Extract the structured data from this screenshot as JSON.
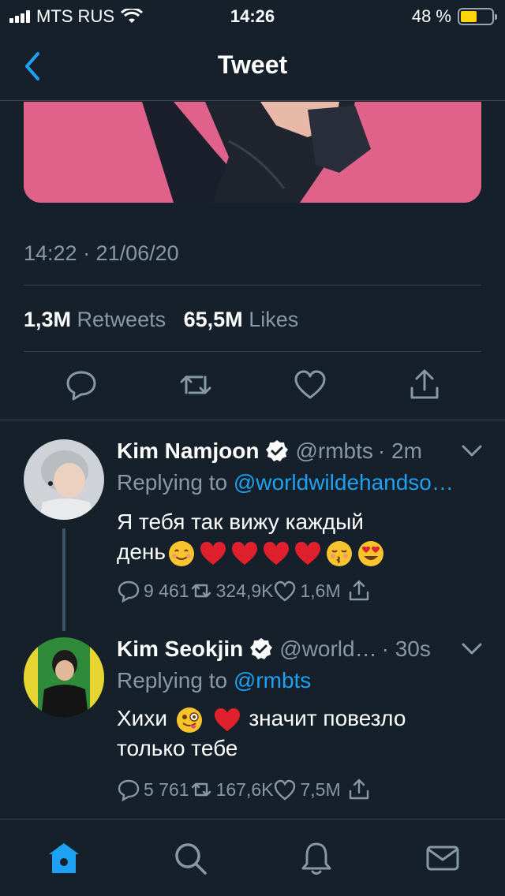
{
  "status_bar": {
    "carrier": "MTS RUS",
    "time": "14:26",
    "battery_percent": "48 %",
    "battery_level": 0.48
  },
  "nav": {
    "title": "Tweet"
  },
  "tweet": {
    "timestamp": "14:22 · 21/06/20",
    "retweets_count": "1,3M",
    "retweets_label": "Retweets",
    "likes_count": "65,5M",
    "likes_label": "Likes"
  },
  "replies": [
    {
      "name": "Kim Namjoon",
      "handle": "@rmbts",
      "time": "· 2m",
      "replying_prefix": "Replying to",
      "replying_to": "@worldwildehandso…",
      "text_line1": "Я тебя так вижу каждый",
      "text_line2": "день",
      "replies": "9 461",
      "retweets": "324,9K",
      "likes": "1,6M"
    },
    {
      "name": "Kim Seokjin",
      "handle": "@world…",
      "time": "· 30s",
      "replying_prefix": "Replying to",
      "replying_to": "@rmbts",
      "text_pre": "Хихи",
      "text_post": "значит повезло",
      "text_line2": "только тебе",
      "replies": "5 761",
      "retweets": "167,6K",
      "likes": "7,5M"
    }
  ],
  "icons": [
    "back-chevron-icon",
    "reply-icon",
    "retweet-icon",
    "like-icon",
    "share-icon",
    "verified-icon",
    "chevron-down-icon",
    "home-icon",
    "search-icon",
    "notifications-icon",
    "messages-icon"
  ],
  "colors": {
    "background": "#15202b",
    "accent": "#1da1f2",
    "muted": "#8899a6",
    "divider": "#38444d"
  }
}
